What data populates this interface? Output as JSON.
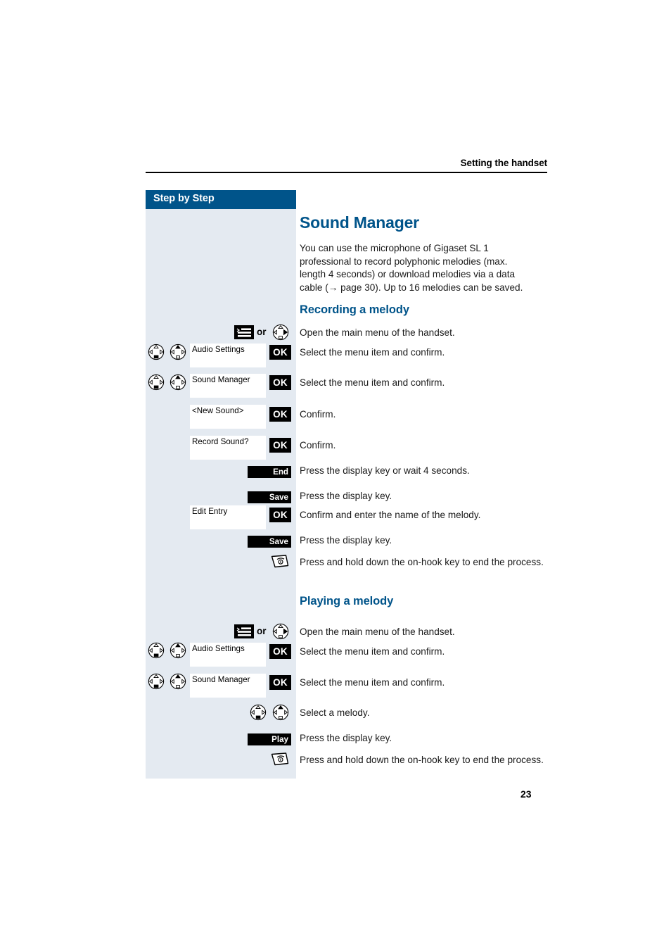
{
  "header": {
    "running_head": "Setting the handset"
  },
  "sidebar": {
    "title": "Step by Step"
  },
  "page_number": "23",
  "section": {
    "title": "Sound Manager",
    "intro": "You can use the microphone of Gigaset SL 1 professional to record polyphonic melodies (max. length 4 seconds) or download melodies via a data cable (→ page 30). Up to 16 melodies can be saved."
  },
  "subsections": [
    {
      "id": "recording",
      "title": "Recording a melody",
      "steps": [
        {
          "keys": [
            "menu-key",
            "or",
            "nav-key-right"
          ],
          "text": "Open the main menu of the handset."
        },
        {
          "keys": [
            "nav-key-down",
            "nav-key-up"
          ],
          "field": "Audio Settings",
          "softkey": "OK",
          "text": "Select the menu item and confirm."
        },
        {
          "keys": [
            "nav-key-down",
            "nav-key-up"
          ],
          "field": "Sound Manager",
          "softkey": "OK",
          "text": "Select the menu item and confirm."
        },
        {
          "field": "<New Sound>",
          "softkey": "OK",
          "text": "Confirm."
        },
        {
          "field": "Record Sound?",
          "softkey": "OK",
          "text": "Confirm."
        },
        {
          "displaykey": "End",
          "text": "Press the display key or wait 4 seconds."
        },
        {
          "displaykey": "Save",
          "text": "Press the display key."
        },
        {
          "field": "Edit Entry",
          "softkey": "OK",
          "text": "Confirm and enter the name of the melody."
        },
        {
          "displaykey": "Save",
          "text": "Press the display key."
        },
        {
          "keys": [
            "on-hook-key"
          ],
          "text": "Press and hold down the on-hook key to end the process."
        }
      ]
    },
    {
      "id": "playing",
      "title": "Playing a melody",
      "steps": [
        {
          "keys": [
            "menu-key",
            "or",
            "nav-key-right"
          ],
          "text": "Open the main menu of the handset."
        },
        {
          "keys": [
            "nav-key-down",
            "nav-key-up"
          ],
          "field": "Audio Settings",
          "softkey": "OK",
          "text": "Select the menu item and confirm."
        },
        {
          "keys": [
            "nav-key-down",
            "nav-key-up"
          ],
          "field": "Sound Manager",
          "softkey": "OK",
          "text": "Select the menu item and confirm."
        },
        {
          "keys": [
            "nav-key-down",
            "nav-key-up"
          ],
          "text": "Select a melody."
        },
        {
          "displaykey": "Play",
          "text": "Press the display key."
        },
        {
          "keys": [
            "on-hook-key"
          ],
          "text": "Press and hold down the on-hook key to end the process."
        }
      ]
    }
  ],
  "labels": {
    "or": "or"
  },
  "colors": {
    "accent": "#00548a",
    "sidebar_bg": "#e4eaf1",
    "key_black": "#000000"
  }
}
